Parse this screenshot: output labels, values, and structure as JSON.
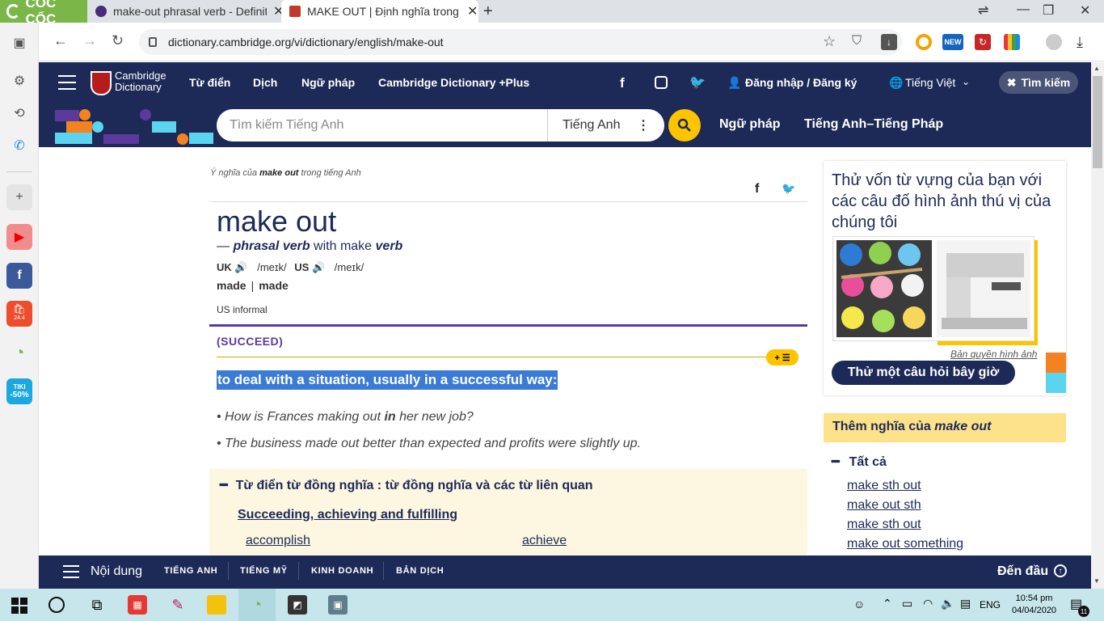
{
  "browser": {
    "brand": "CỐC CỐC",
    "tabs": [
      {
        "title": "make-out phrasal verb - Definiti"
      },
      {
        "title": "MAKE OUT | Định nghĩa trong"
      }
    ],
    "url": "dictionary.cambridge.org/vi/dictionary/english/make-out",
    "ext_new_badge": "NEW"
  },
  "sidebar": {
    "shopee_badge": "24.4",
    "tiki_label": "TIKI",
    "tiki_discount": "-50%"
  },
  "site": {
    "logo_line1": "Cambridge",
    "logo_line2": "Dictionary",
    "nav": [
      "Từ điển",
      "Dịch",
      "Ngữ pháp",
      "Cambridge Dictionary +Plus"
    ],
    "login": "Đăng nhập / Đăng ký",
    "language": "Tiếng Việt",
    "search_toggle": "Tìm kiếm",
    "search_placeholder": "Tìm kiếm Tiếng Anh",
    "search_lang": "Tiếng Anh",
    "sec_links": [
      "Ngữ pháp",
      "Tiếng Anh–Tiếng Pháp"
    ]
  },
  "entry": {
    "crumb_pre": "Ý nghĩa của ",
    "crumb_word": "make out",
    "crumb_post": " trong tiếng Anh",
    "headword": "make out",
    "pos_dash": "— ",
    "pos": "phrasal verb",
    "pos_with": " with make ",
    "pos_verb": "verb",
    "uk_label": "UK",
    "uk_ipa": "/meɪk/",
    "us_label": "US",
    "us_ipa": "/meɪk/",
    "form1": "made",
    "form2": "made",
    "register": "US informal",
    "guideword": "(SUCCEED)",
    "plus_label": "+ ☰",
    "definition": "to deal with a situation, usually in a successful way:",
    "ex1_pre": "How is Frances making out ",
    "ex1_b": "in",
    "ex1_post": " her new job?",
    "ex2": "The business made out better than expected and profits were slightly up.",
    "syn_heading": "Từ điển từ đồng nghĩa : từ đồng nghĩa và các từ liên quan",
    "syn_category": "Succeeding, achieving and fulfilling",
    "syn_words": [
      "accomplish",
      "achieve"
    ]
  },
  "right": {
    "quiz_title": "Thử vốn từ vựng của bạn với các câu đố hình ảnh thú vị của chúng tôi",
    "copyright": "Bản quyền hình ảnh",
    "quiz_button": "Thử một câu hỏi bây giờ",
    "more_pre": "Thêm nghĩa của ",
    "more_word": "make out",
    "all": "Tất cả",
    "related": [
      "make sth out",
      "make out sth",
      "make sth out",
      "make out something"
    ]
  },
  "bottom": {
    "menu": "Nội dung",
    "links": [
      "TIẾNG ANH",
      "TIẾNG MỸ",
      "KINH DOANH",
      "BẢN DỊCH"
    ],
    "top": "Đến đầu"
  },
  "taskbar": {
    "lang": "ENG",
    "time": "10:54 pm",
    "date": "04/04/2020",
    "notif_count": "11"
  },
  "colors": {
    "navy": "#1d2a57",
    "yellow": "#fec400",
    "purple": "#5b3a9b",
    "highlight": "#3a7bd5"
  }
}
